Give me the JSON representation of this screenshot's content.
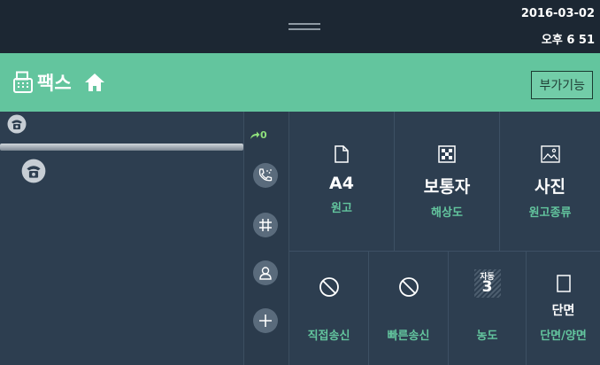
{
  "status": {
    "date": "2016-03-02",
    "time": "오후 6  51"
  },
  "header": {
    "title": "팩스",
    "extra_button": "부가기능"
  },
  "tools": {
    "redial_count": "0"
  },
  "options_top": [
    {
      "value": "A4",
      "label": "원고",
      "icon": "document-icon"
    },
    {
      "value": "보통자",
      "label": "해상도",
      "icon": "resolution-icon"
    },
    {
      "value": "사진",
      "label": "원고종류",
      "icon": "image-icon"
    }
  ],
  "options_bottom": [
    {
      "label": "직접송신",
      "icon": "disabled-icon"
    },
    {
      "label": "빠른송신",
      "icon": "disabled-icon"
    },
    {
      "label": "농도",
      "badge_top": "자동",
      "badge_value": "3",
      "icon": "density-icon"
    },
    {
      "value": "단면",
      "label": "단면/양면",
      "icon": "page-icon"
    }
  ],
  "colors": {
    "accent": "#63c59e",
    "background": "#2d3e50",
    "statusbar": "#1c2733"
  }
}
